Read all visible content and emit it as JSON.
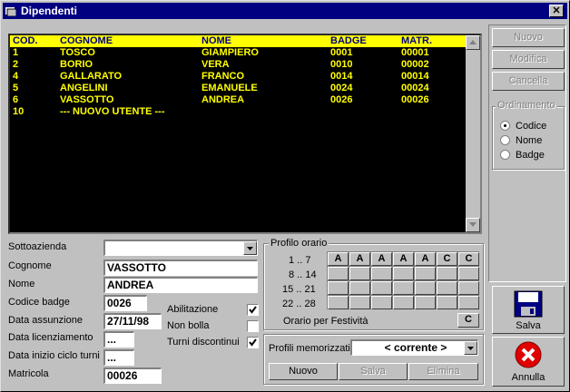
{
  "window": {
    "title": "Dipendenti",
    "close_label": "✕"
  },
  "list": {
    "headers": [
      "COD.",
      "COGNOME",
      "NOME",
      "BADGE",
      "MATR."
    ],
    "rows": [
      [
        "1",
        "TOSCO",
        "GIAMPIERO",
        "0001",
        "00001"
      ],
      [
        "2",
        "BORIO",
        "VERA",
        "0010",
        "00002"
      ],
      [
        "4",
        "GALLARATO",
        "FRANCO",
        "0014",
        "00014"
      ],
      [
        "5",
        "ANGELINI",
        "EMANUELE",
        "0024",
        "00024"
      ],
      [
        "6",
        "VASSOTTO",
        "ANDREA",
        "0026",
        "00026"
      ],
      [
        "10",
        "--- NUOVO UTENTE ---",
        "",
        "",
        ""
      ]
    ]
  },
  "form": {
    "sottoazienda_label": "Sottoazienda",
    "sottoazienda_value": "",
    "cognome_label": "Cognome",
    "cognome_value": "VASSOTTO",
    "nome_label": "Nome",
    "nome_value": "ANDREA",
    "badge_label": "Codice badge",
    "badge_value": "0026",
    "assunzione_label": "Data assunzione",
    "assunzione_value": "27/11/98",
    "licenziamento_label": "Data licenziamento",
    "licenziamento_value": "...",
    "inizio_turni_label": "Data inizio ciclo turni",
    "inizio_turni_value": "...",
    "matricola_label": "Matricola",
    "matricola_value": "00026",
    "abilitazione_label": "Abilitazione",
    "abilitazione_checked": true,
    "non_bolla_label": "Non bolla",
    "non_bolla_checked": false,
    "turni_label": "Turni discontinui",
    "turni_checked": true
  },
  "profilo": {
    "title": "Profilo orario",
    "row_labels": [
      "1 .. 7",
      "8 .. 14",
      "15 .. 21",
      "22 .. 28"
    ],
    "first_row": [
      "A",
      "A",
      "A",
      "A",
      "A",
      "C",
      "C"
    ],
    "festivita_label": "Orario per Festività",
    "festivita_value": "C",
    "memorizzati_label": "Profili memorizzati",
    "memorizzati_value": "< corrente >",
    "nuovo_label": "Nuovo",
    "salva_label": "Salva",
    "elimina_label": "Elimina"
  },
  "side": {
    "nuovo_label": "Nuovo",
    "modifica_label": "Modifica",
    "cancella_label": "Cancella",
    "ordinamento_title": "Ordinamento",
    "sort_options": [
      "Codice",
      "Nome",
      "Badge"
    ],
    "sort_selected": "Codice",
    "salva_label": "Salva",
    "annulla_label": "Annulla"
  },
  "colors": {
    "title_bar": "#000080",
    "list_bg": "#000000",
    "list_text": "#ffff00",
    "header_bg": "#ffff00",
    "header_text": "#000080"
  }
}
